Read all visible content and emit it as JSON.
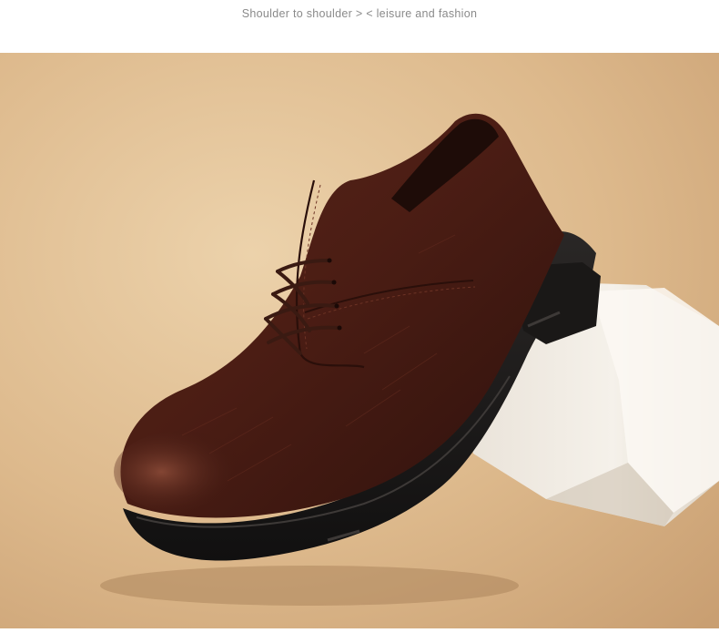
{
  "header": {
    "title": "Shoulder to shoulder > < leisure and fashion"
  },
  "product_photo": {
    "subject": "shoe-icon",
    "colors": {
      "background_light": "#e7c9a0",
      "background_dark": "#caa174",
      "leather": "#4a1d14",
      "leather_highlight": "#7a3a2b",
      "sole": "#1c1a19",
      "prop_block": "#f1ece4"
    }
  }
}
